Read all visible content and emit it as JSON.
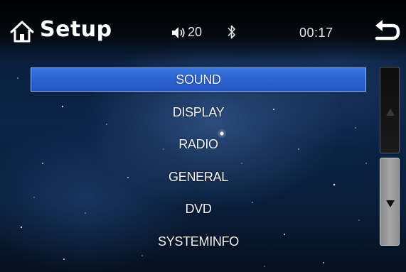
{
  "header": {
    "title": "Setup",
    "volume": "20",
    "clock": "00:17",
    "icons": {
      "home": "home-icon",
      "volume": "speaker-icon",
      "bluetooth": "bluetooth-icon",
      "back": "back-arrow-icon"
    }
  },
  "menu": {
    "items": [
      {
        "label": "SOUND",
        "selected": true
      },
      {
        "label": "DISPLAY",
        "selected": false
      },
      {
        "label": "RADIO",
        "selected": false
      },
      {
        "label": "GENERAL",
        "selected": false
      },
      {
        "label": "DVD",
        "selected": false
      },
      {
        "label": "SYSTEMINFO",
        "selected": false
      }
    ]
  },
  "scroll": {
    "up_icon": "triangle-up-icon",
    "down_icon": "triangle-down-icon"
  },
  "colors": {
    "selection": "#2a63d0",
    "selection_border": "#8fb3ff",
    "background": "#0b2447",
    "text": "#ffffff"
  }
}
